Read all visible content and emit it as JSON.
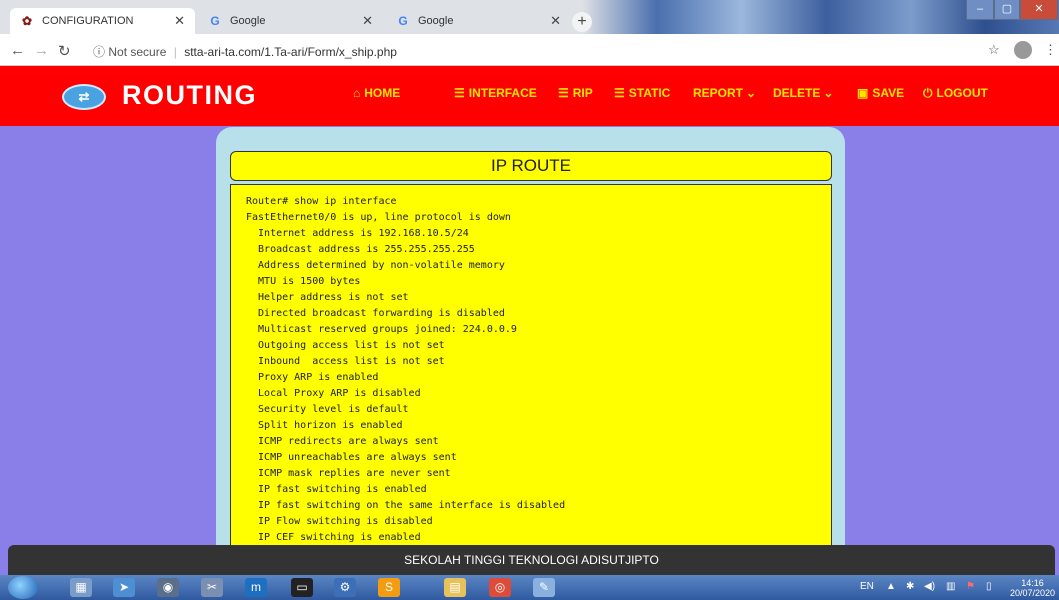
{
  "browser": {
    "tabs": [
      {
        "label": "CONFIGURATION",
        "icon": "router-favicon"
      },
      {
        "label": "Google",
        "icon": "google-favicon"
      },
      {
        "label": "Google",
        "icon": "google-favicon"
      }
    ],
    "not_secure": "Not secure",
    "url": "stta-ari-ta.com/1.Ta-ari/Form/x_ship.php"
  },
  "header": {
    "brand": "ROUTING",
    "nav": [
      {
        "label": "HOME",
        "icon": "home-icon"
      },
      {
        "label": "INTERFACE",
        "icon": "list-icon"
      },
      {
        "label": "RIP",
        "icon": "list-icon"
      },
      {
        "label": "STATIC",
        "icon": "list-icon"
      },
      {
        "label": "REPORT",
        "icon": "chevron-down-icon"
      },
      {
        "label": "DELETE",
        "icon": "chevron-down-icon"
      },
      {
        "label": "SAVE",
        "icon": "save-icon"
      },
      {
        "label": "LOGOUT",
        "icon": "power-icon"
      }
    ]
  },
  "main": {
    "title": "IP ROUTE",
    "output_lines": [
      "Router# show ip interface",
      "FastEthernet0/0 is up, line protocol is down",
      "  Internet address is 192.168.10.5/24",
      "  Broadcast address is 255.255.255.255",
      "  Address determined by non-volatile memory",
      "  MTU is 1500 bytes",
      "  Helper address is not set",
      "  Directed broadcast forwarding is disabled",
      "  Multicast reserved groups joined: 224.0.0.9",
      "  Outgoing access list is not set",
      "  Inbound  access list is not set",
      "  Proxy ARP is enabled",
      "  Local Proxy ARP is disabled",
      "  Security level is default",
      "  Split horizon is enabled",
      "  ICMP redirects are always sent",
      "  ICMP unreachables are always sent",
      "  ICMP mask replies are never sent",
      "  IP fast switching is enabled",
      "  IP fast switching on the same interface is disabled",
      "  IP Flow switching is disabled",
      "  IP CEF switching is enabled"
    ]
  },
  "footer": {
    "text": "SEKOLAH TINGGI TEKNOLOGI ADISUTJIPTO"
  },
  "taskbar": {
    "lang": "EN",
    "time": "14:16",
    "date": "20/07/2020"
  },
  "colors": {
    "header_bg": "#ff0000",
    "nav_text": "#ffe600",
    "page_bg": "#8a7fe8",
    "panel_bg": "#b7e0ea",
    "output_bg": "#ffff00",
    "footer_bg": "#333333"
  }
}
